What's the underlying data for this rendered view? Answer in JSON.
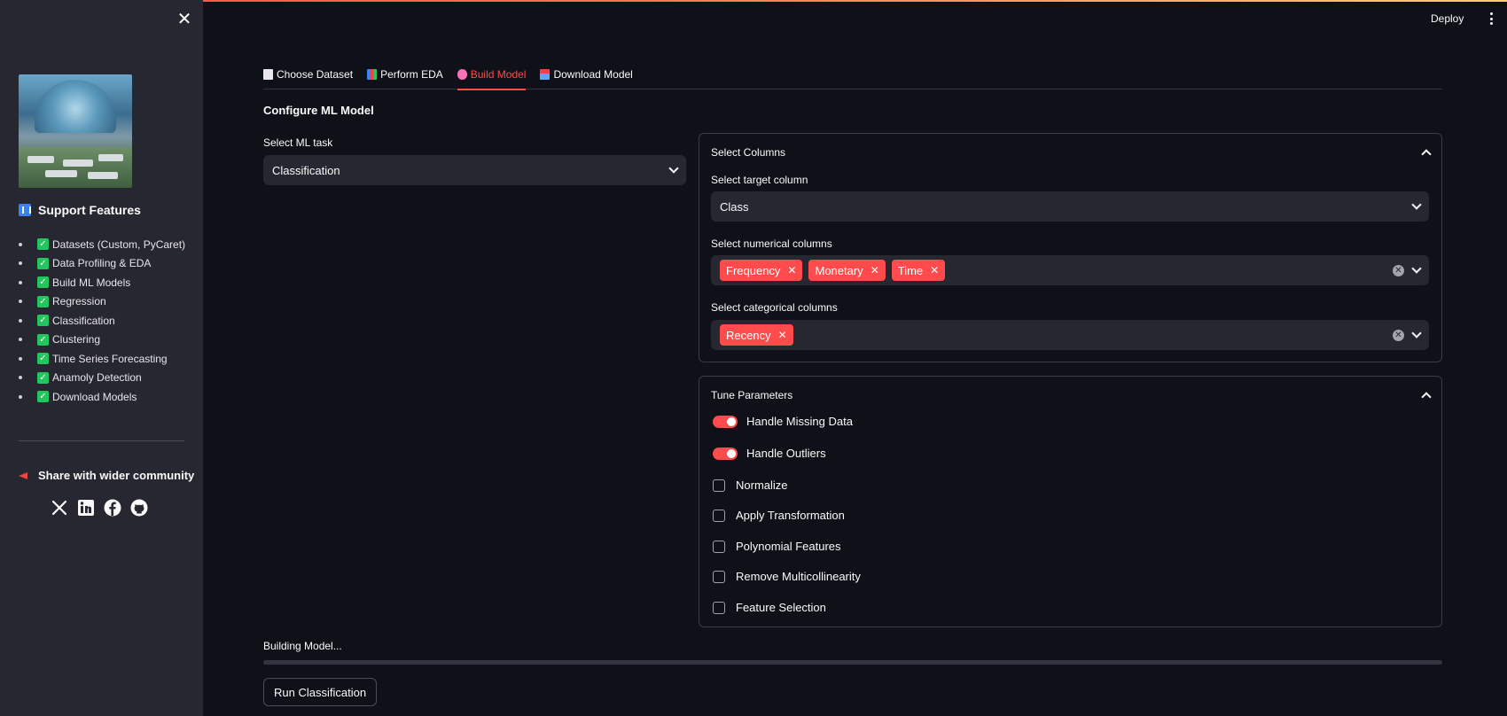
{
  "sidebar": {
    "close_icon": "close-icon",
    "features_heading": "Support Features",
    "features": [
      "Datasets (Custom, PyCaret)",
      "Data Profiling & EDA",
      "Build ML Models",
      "Regression",
      "Classification",
      "Clustering",
      "Time Series Forecasting",
      "Anamoly Detection",
      "Download Models"
    ],
    "share_heading": "Share with wider community",
    "socials": [
      "x-icon",
      "linkedin-icon",
      "facebook-icon",
      "github-icon"
    ]
  },
  "header": {
    "deploy_label": "Deploy"
  },
  "tabs": [
    {
      "label": "Choose Dataset",
      "icon": "page-icon",
      "active": false
    },
    {
      "label": "Perform EDA",
      "icon": "bar-chart-icon",
      "active": false
    },
    {
      "label": "Build Model",
      "icon": "brain-icon",
      "active": true
    },
    {
      "label": "Download Model",
      "icon": "mailbox-icon",
      "active": false
    }
  ],
  "main": {
    "section_title": "Configure ML Model",
    "ml_task": {
      "label": "Select ML task",
      "value": "Classification"
    },
    "columns_panel": {
      "title": "Select Columns",
      "target_label": "Select target column",
      "target_value": "Class",
      "numerical_label": "Select numerical columns",
      "numerical_values": [
        "Frequency",
        "Monetary",
        "Time"
      ],
      "categorical_label": "Select categorical columns",
      "categorical_values": [
        "Recency"
      ]
    },
    "tune_panel": {
      "title": "Tune Parameters",
      "toggles": [
        {
          "label": "Handle Missing Data",
          "on": true
        },
        {
          "label": "Handle Outliers",
          "on": true
        }
      ],
      "checkboxes": [
        {
          "label": "Normalize",
          "checked": false
        },
        {
          "label": "Apply Transformation",
          "checked": false
        },
        {
          "label": "Polynomial Features",
          "checked": false
        },
        {
          "label": "Remove Multicollinearity",
          "checked": false
        },
        {
          "label": "Feature Selection",
          "checked": false
        }
      ]
    },
    "progress": {
      "label": "Building Model...",
      "fraction": 0
    },
    "run_button_label": "Run Classification"
  },
  "colors": {
    "accent": "#ff4b4b",
    "background": "#0e1117",
    "sidebar": "#262730",
    "check_green": "#22c55e"
  }
}
